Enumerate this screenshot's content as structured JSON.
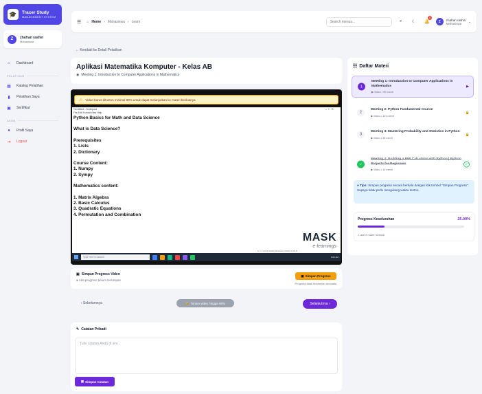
{
  "sidebar": {
    "brand_title": "Tracer Study",
    "brand_subtitle": "MANAGEMENT SYSTEM",
    "user_initial": "Z",
    "user_name": "zhafran rashin",
    "user_role": "Mahasiswa",
    "section_pelatihan": "PELATIHAN",
    "section_akun": "AKUN",
    "items": [
      {
        "label": "Dashboard",
        "icon": "home-icon"
      },
      {
        "label": "Katalog Pelatihan",
        "icon": "catalog-icon"
      },
      {
        "label": "Pelatihan Saya",
        "icon": "book-icon"
      },
      {
        "label": "Sertifikat",
        "icon": "certificate-icon"
      },
      {
        "label": "Profil Saya",
        "icon": "user-icon"
      },
      {
        "label": "Logout",
        "icon": "logout-icon"
      }
    ]
  },
  "header": {
    "crumbs": [
      "Home",
      "Mahasiswa",
      "Learn"
    ],
    "search_placeholder": "Search menus...",
    "notif_count": "3",
    "user_initial": "Z",
    "user_name": "zhafran rashin",
    "user_role": "Mahasiswa"
  },
  "main": {
    "back_link": "← Kembali ke Detail Pelatihan",
    "title": "Aplikasi Matematika Komputer - Kelas AB",
    "subtitle": "Meeting 1: Introduction to Computer Applications in Mathematics",
    "warning": "Video harus ditonton minimal 90% untuk dapat melanjutkan ke materi berikutnya",
    "video": {
      "window_title": "*Untitled - Notepad",
      "menu": "File  Edit  Format  View  Help",
      "lines": [
        "Python Basics for Math and Data Science",
        "",
        "What is Data Science?",
        "",
        "Prerequisites",
        "1. Lists",
        "2. Dictionary",
        "",
        "Course Content:",
        "1. Numpy",
        "2. Sympy",
        "",
        "Mathematics content:",
        "",
        "1. Matrix Algebra",
        "2. Basic Calculus",
        "3. Quadratic Equations",
        "4. Permutation and Combination"
      ],
      "watermark": "MASK",
      "watermark_sub": "e-learnings",
      "status": "Ln 1, Col 40     100%     Windows (CRLF)     UTF-8",
      "taskbar_search": "Type here to search",
      "taskbar_time": "9:02 AM"
    },
    "save": {
      "title": "Simpan Progress Video",
      "subtitle": "Ada progress belum tersimpan",
      "button": "Simpan Progress",
      "note": "Progress tidak tersimpan otomatis"
    },
    "nav": {
      "prev": "‹ Sebelumnya",
      "watch": "Tonton video hingga 90%",
      "next": "Selanjutnya ›"
    },
    "notes": {
      "title": "Catatan Pribadi",
      "placeholder": "Tulis catatan Anda di sini...",
      "button": "Simpan Catatan"
    }
  },
  "panel": {
    "title": "Daftar Materi",
    "lessons": [
      {
        "num": "1",
        "title": "Meeting 1: Introduction to Computer Applications in Mathematics",
        "meta": "Video • 90 menit",
        "state": "active"
      },
      {
        "num": "2",
        "title": "Meeting 2: Python Fundamental Course",
        "meta": "Video • 123 menit",
        "state": "locked"
      },
      {
        "num": "3",
        "title": "Meeting 3: Mastering Probability and Statistics in Python",
        "meta": "Video • 48 menit",
        "state": "locked"
      },
      {
        "num": "4",
        "title": "Meeting 4: Building a BMI Calculator with Python | Python Projects for Beginners",
        "meta": "Video • 14 menit",
        "state": "done"
      }
    ],
    "tips_label": "Tips:",
    "tips_text": "Simpan progress secara berkala dengan klik tombol \"Simpan Progress\". Supaya tidak perlu mengulang waktu tonton.",
    "progress_label": "Progress Keseluruhan",
    "progress_value": "25.00%",
    "progress_fraction": 0.25,
    "progress_sub": "1 dari 4 materi selesai"
  },
  "colors": {
    "accent": "#6d28d9",
    "brand": "#4f46e5",
    "warning": "#f59e0b",
    "success": "#22c55e"
  }
}
